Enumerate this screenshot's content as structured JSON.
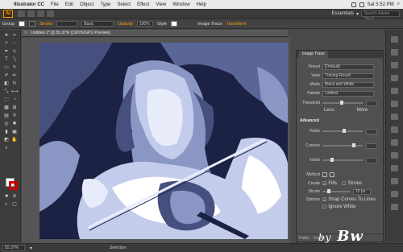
{
  "menubar": {
    "app": "Illustrator CC",
    "items": [
      "File",
      "Edit",
      "Object",
      "Type",
      "Select",
      "Effect",
      "View",
      "Window",
      "Help"
    ],
    "clock": "Sat 5:52 PM"
  },
  "apptoolbar": {
    "logo": "Ai",
    "workspace": "Essentials",
    "search_placeholder": "Search Adobe Stock"
  },
  "controlbar": {
    "selection": "Group",
    "stroke_label": "Stroke",
    "brush_label": "Basic",
    "opacity_label": "Opacity",
    "opacity_value": "100%",
    "style_label": "Style",
    "image_trace_label": "Image Trace",
    "transform_label": "Transform"
  },
  "document": {
    "tab_name": "Untitled-1* @ 55.37% (CMYK/GPU Preview)",
    "close": "✕"
  },
  "panel": {
    "title": "Image Trace",
    "preset_label": "Preset",
    "preset_value": "[Default]",
    "view_label": "View",
    "view_value": "Tracing Result",
    "mode_label": "Mode",
    "mode_value": "Black and White",
    "palette_label": "Palette",
    "palette_value": "Limited",
    "threshold_label": "Threshold",
    "less": "Less",
    "more": "More",
    "advanced_label": "Advanced",
    "paths_label": "Paths",
    "corners_label": "Corners",
    "noise_label": "Noise",
    "method_label": "Method",
    "create_label": "Create",
    "fills_label": "Fills",
    "stroke_label": "Stroke",
    "stroke_value": "10 px",
    "options_label": "Options",
    "snap_label": "Snap Curves To Lines",
    "ignore_label": "Ignore White",
    "paths_count_label": "Paths",
    "colors_count_label": "Colors"
  },
  "status": {
    "zoom": "55.37%",
    "mode": "Selection"
  },
  "watermark": {
    "text": "by",
    "name": "Bw"
  }
}
